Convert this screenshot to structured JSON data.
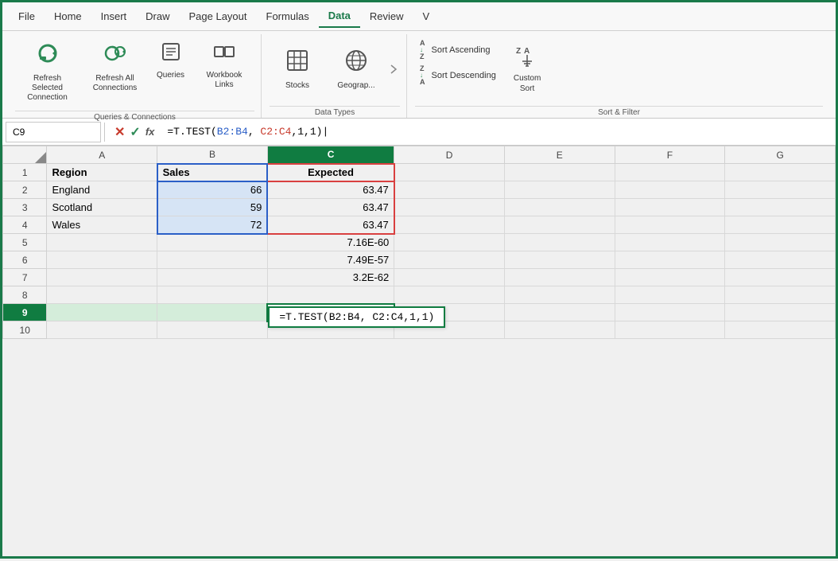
{
  "menu": {
    "items": [
      "File",
      "Home",
      "Insert",
      "Draw",
      "Page Layout",
      "Formulas",
      "Data",
      "Review",
      "V"
    ],
    "active": "Data"
  },
  "ribbon": {
    "groups": [
      {
        "label": "Queries & Connections",
        "buttons": [
          {
            "id": "refresh-selected",
            "icon": "⟳",
            "label": "Refresh Selected\nConnection"
          },
          {
            "id": "refresh-all",
            "icon": "⟳⟳",
            "label": "Refresh All\nConnections"
          },
          {
            "id": "queries",
            "icon": "📋",
            "label": "Queries"
          },
          {
            "id": "workbook-links",
            "icon": "🔗",
            "label": "Workbook\nLinks"
          }
        ]
      },
      {
        "label": "Data Types",
        "buttons": [
          {
            "id": "stocks",
            "icon": "🏛",
            "label": "Stocks"
          },
          {
            "id": "geography",
            "icon": "🗺",
            "label": "Geograp..."
          }
        ]
      },
      {
        "label": "Sort & Filter",
        "sort_buttons": [
          {
            "id": "sort-asc",
            "label": "Sort Ascending"
          },
          {
            "id": "sort-desc",
            "label": "Sort Descending"
          }
        ],
        "custom_label": "Custom\nSort"
      }
    ]
  },
  "formula_bar": {
    "cell_ref": "C9",
    "formula_parts": [
      {
        "text": "=T.TEST(",
        "color": "black"
      },
      {
        "text": "B2:B4",
        "color": "blue"
      },
      {
        "text": ", ",
        "color": "black"
      },
      {
        "text": "C2:C4",
        "color": "red"
      },
      {
        "text": ",1,1)",
        "color": "black"
      }
    ]
  },
  "spreadsheet": {
    "col_headers": [
      "",
      "A",
      "B",
      "C",
      "D",
      "E",
      "F",
      "G"
    ],
    "active_col": "C",
    "rows": [
      {
        "num": 1,
        "cells": [
          "",
          "Region",
          "Sales",
          "Expected",
          "",
          "",
          "",
          ""
        ]
      },
      {
        "num": 2,
        "cells": [
          "",
          "England",
          "66",
          "63.47",
          "",
          "",
          "",
          ""
        ]
      },
      {
        "num": 3,
        "cells": [
          "",
          "Scotland",
          "59",
          "63.47",
          "",
          "",
          "",
          ""
        ]
      },
      {
        "num": 4,
        "cells": [
          "",
          "Wales",
          "72",
          "63.47",
          "",
          "",
          "",
          ""
        ]
      },
      {
        "num": 5,
        "cells": [
          "",
          "",
          "",
          "7.16E-60",
          "",
          "",
          "",
          ""
        ]
      },
      {
        "num": 6,
        "cells": [
          "",
          "",
          "",
          "7.49E-57",
          "",
          "",
          "",
          ""
        ]
      },
      {
        "num": 7,
        "cells": [
          "",
          "",
          "",
          "3.2E-62",
          "",
          "",
          "",
          ""
        ]
      },
      {
        "num": 8,
        "cells": [
          "",
          "",
          "",
          "",
          "",
          "",
          "",
          ""
        ]
      },
      {
        "num": 9,
        "cells": [
          "",
          "",
          "",
          "=T.TEST(B2:B4, C2:C4,1,1)",
          "",
          "",
          "",
          ""
        ]
      },
      {
        "num": 10,
        "cells": [
          "",
          "",
          "",
          "",
          "",
          "",
          "",
          ""
        ]
      }
    ],
    "active_row": 9,
    "formula_preview": "=T.TEST(B2:B4, C2:C4,1,1)"
  }
}
